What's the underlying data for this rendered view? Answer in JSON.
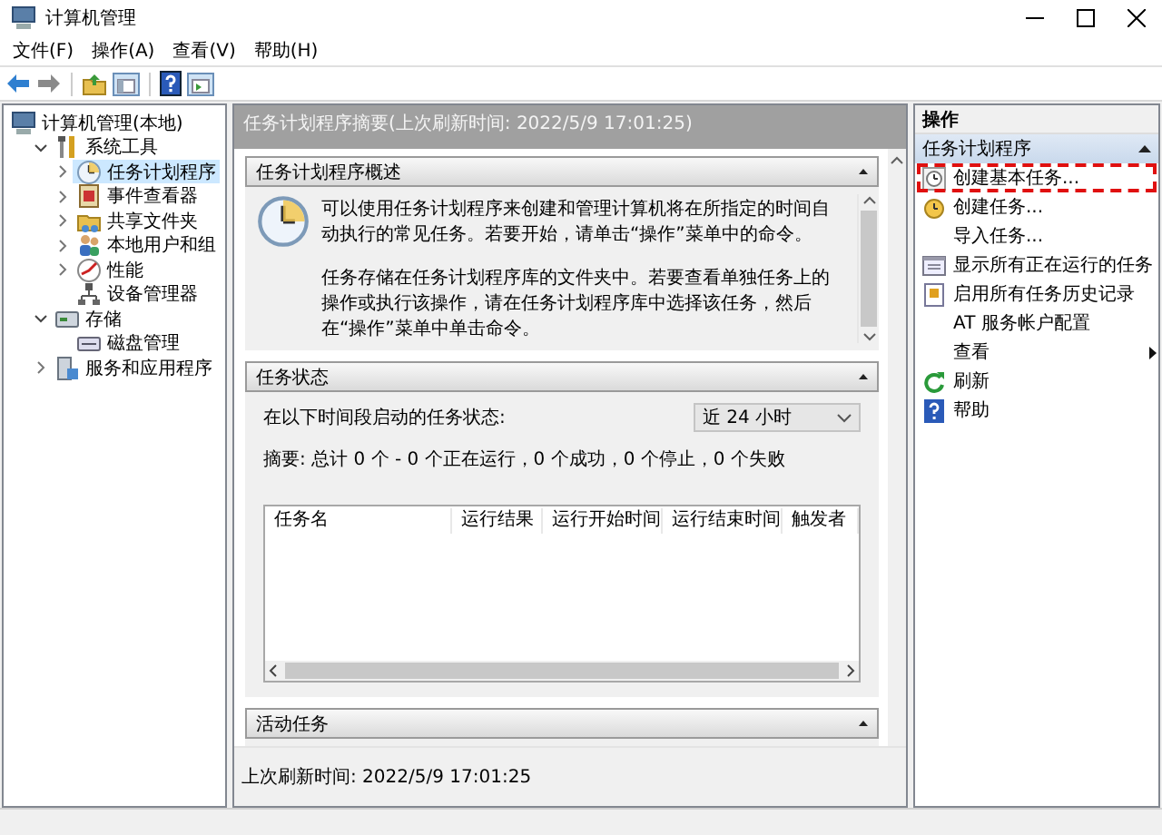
{
  "window": {
    "title": "计算机管理"
  },
  "menu": [
    {
      "label": "文件(F)"
    },
    {
      "label": "操作(A)"
    },
    {
      "label": "查看(V)"
    },
    {
      "label": "帮助(H)"
    }
  ],
  "tree": [
    {
      "label": "计算机管理(本地)",
      "kind": "computer",
      "selected": false,
      "children": [
        {
          "label": "系统工具",
          "kind": "tools",
          "expanded": true,
          "selected": false,
          "children": [
            {
              "label": "任务计划程序",
              "kind": "clock",
              "expanded": false,
              "selected": true
            },
            {
              "label": "事件查看器",
              "kind": "event",
              "expanded": false,
              "selected": false
            },
            {
              "label": "共享文件夹",
              "kind": "folder",
              "expanded": false,
              "selected": false
            },
            {
              "label": "本地用户和组",
              "kind": "users",
              "expanded": false,
              "selected": false
            },
            {
              "label": "性能",
              "kind": "perf",
              "expanded": false,
              "selected": false
            },
            {
              "label": "设备管理器",
              "kind": "device",
              "selected": false
            }
          ]
        },
        {
          "label": "存储",
          "kind": "storage",
          "expanded": true,
          "selected": false,
          "children": [
            {
              "label": "磁盘管理",
              "kind": "disk",
              "selected": false
            }
          ]
        },
        {
          "label": "服务和应用程序",
          "kind": "services",
          "expanded": false,
          "selected": false
        }
      ]
    }
  ],
  "summary": {
    "title": "任务计划程序摘要(上次刷新时间: 2022/5/9 17:01:25)",
    "sections": [
      {
        "kind": "overview",
        "title": "任务计划程序概述",
        "paragraphs": [
          "可以使用任务计划程序来创建和管理计算机将在所指定的时间自动执行的常见任务。若要开始，请单击“操作”菜单中的命令。",
          "任务存储在任务计划程序库的文件夹中。若要查看单独任务上的操作或执行该操作，请在任务计划程序库中选择该任务，然后在“操作”菜单中单击命令。"
        ]
      },
      {
        "kind": "status",
        "title": "任务状态",
        "label": "在以下时间段启动的任务状态:",
        "period": "近 24 小时",
        "summary": "摘要: 总计 0 个 - 0 个正在运行，0 个成功，0 个停止，0 个失败",
        "columns": [
          "任务名",
          "运行结果",
          "运行开始时间",
          "运行结束时间",
          "触发者"
        ]
      },
      {
        "kind": "active",
        "title": "活动任务"
      }
    ],
    "footer": "上次刷新时间: 2022/5/9 17:01:25"
  },
  "actions": {
    "title": "操作",
    "group": "任务计划程序",
    "items": [
      {
        "label": "创建基本任务...",
        "kind": "basic-task",
        "highlighted": true
      },
      {
        "label": "创建任务...",
        "kind": "task",
        "highlighted": false
      },
      {
        "label": "导入任务...",
        "kind": "plain",
        "highlighted": false
      },
      {
        "label": "显示所有正在运行的任务",
        "kind": "running",
        "highlighted": false
      },
      {
        "label": "启用所有任务历史记录",
        "kind": "history",
        "highlighted": false
      },
      {
        "label": "AT 服务帐户配置",
        "kind": "plain",
        "highlighted": false
      },
      {
        "label": "查看",
        "kind": "submenu",
        "highlighted": false
      },
      {
        "label": "刷新",
        "kind": "refresh",
        "highlighted": false
      },
      {
        "label": "帮助",
        "kind": "help",
        "highlighted": false
      }
    ]
  }
}
